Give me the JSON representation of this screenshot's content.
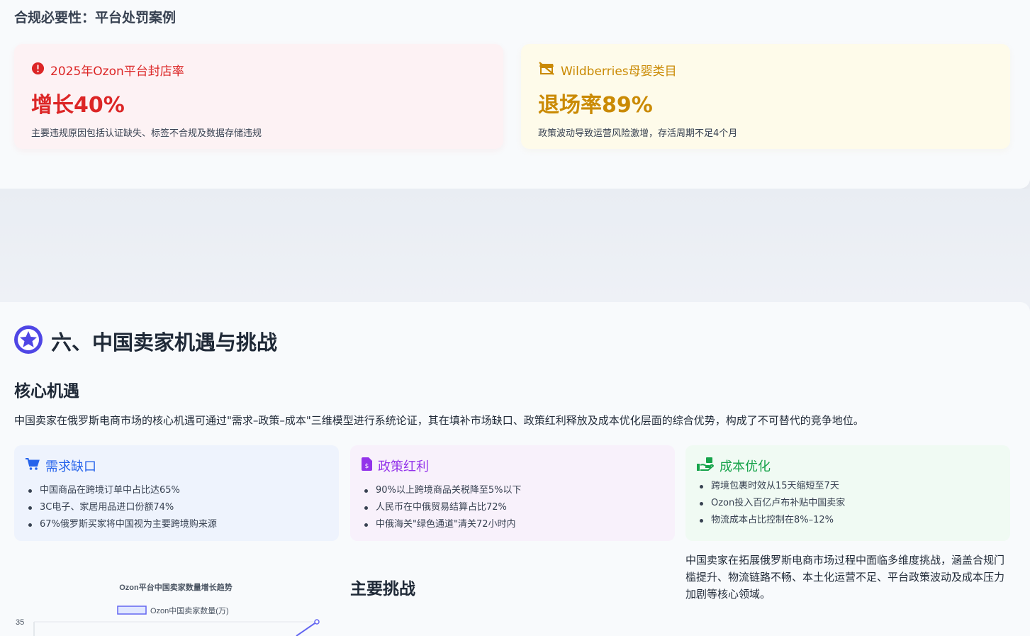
{
  "compliance": {
    "title": "合规必要性：平台处罚案例",
    "cases": [
      {
        "head": "2025年Ozon平台封店率",
        "value": "增长40%",
        "desc": "主要违规原因包括认证缺失、标签不合规及数据存储违规",
        "icon": "alert-circle-icon",
        "color": "#dc2626"
      },
      {
        "head": "Wildberries母婴类目",
        "value": "退场率89%",
        "desc": "政策波动导致运营风险激增，存活周期不足4个月",
        "icon": "store-slash-icon",
        "color": "#ca8a04"
      }
    ]
  },
  "section": {
    "title": "六、中国卖家机遇与挑战",
    "icon": "star-badge-icon",
    "accent": "#4f46e5"
  },
  "opportunities": {
    "title": "核心机遇",
    "intro": "中国卖家在俄罗斯电商市场的核心机遇可通过\"需求–政策–成本\"三维模型进行系统论证，其在填补市场缺口、政策红利释放及成本优化层面的综合优势，构成了不可替代的竞争地位。",
    "cards": [
      {
        "title": "需求缺口",
        "icon": "cart-icon",
        "items": [
          "中国商品在跨境订单中占比达65%",
          "3C电子、家居用品进口份额74%",
          "67%俄罗斯买家将中国视为主要跨境购来源"
        ]
      },
      {
        "title": "政策红利",
        "icon": "invoice-dollar-icon",
        "items": [
          "90%以上跨境商品关税降至5%以下",
          "人民币在中俄贸易结算占比72%",
          "中俄海关\"绿色通道\"清关72小时内"
        ]
      },
      {
        "title": "成本优化",
        "icon": "hand-holding-dollar-icon",
        "items": [
          "跨境包裹时效从15天缩短至7天",
          "Ozon投入百亿卢布补贴中国卖家",
          "物流成本占比控制在8%–12%"
        ]
      }
    ]
  },
  "challenges": {
    "title": "主要挑战",
    "text": "中国卖家在拓展俄罗斯电商市场过程中面临多维度挑战，涵盖合规门槛提升、物流链路不畅、本土化运营不足、平台政策波动及成本压力加剧等核心领域。"
  },
  "chart_data": {
    "type": "line",
    "title": "Ozon平台中国卖家数量增长趋势",
    "series": [
      {
        "name": "Ozon中国卖家数量(万)",
        "values": [
          35
        ]
      }
    ],
    "y_ticks_visible": [
      "35"
    ],
    "legend_position": "top-center",
    "color": "#6366f1"
  }
}
